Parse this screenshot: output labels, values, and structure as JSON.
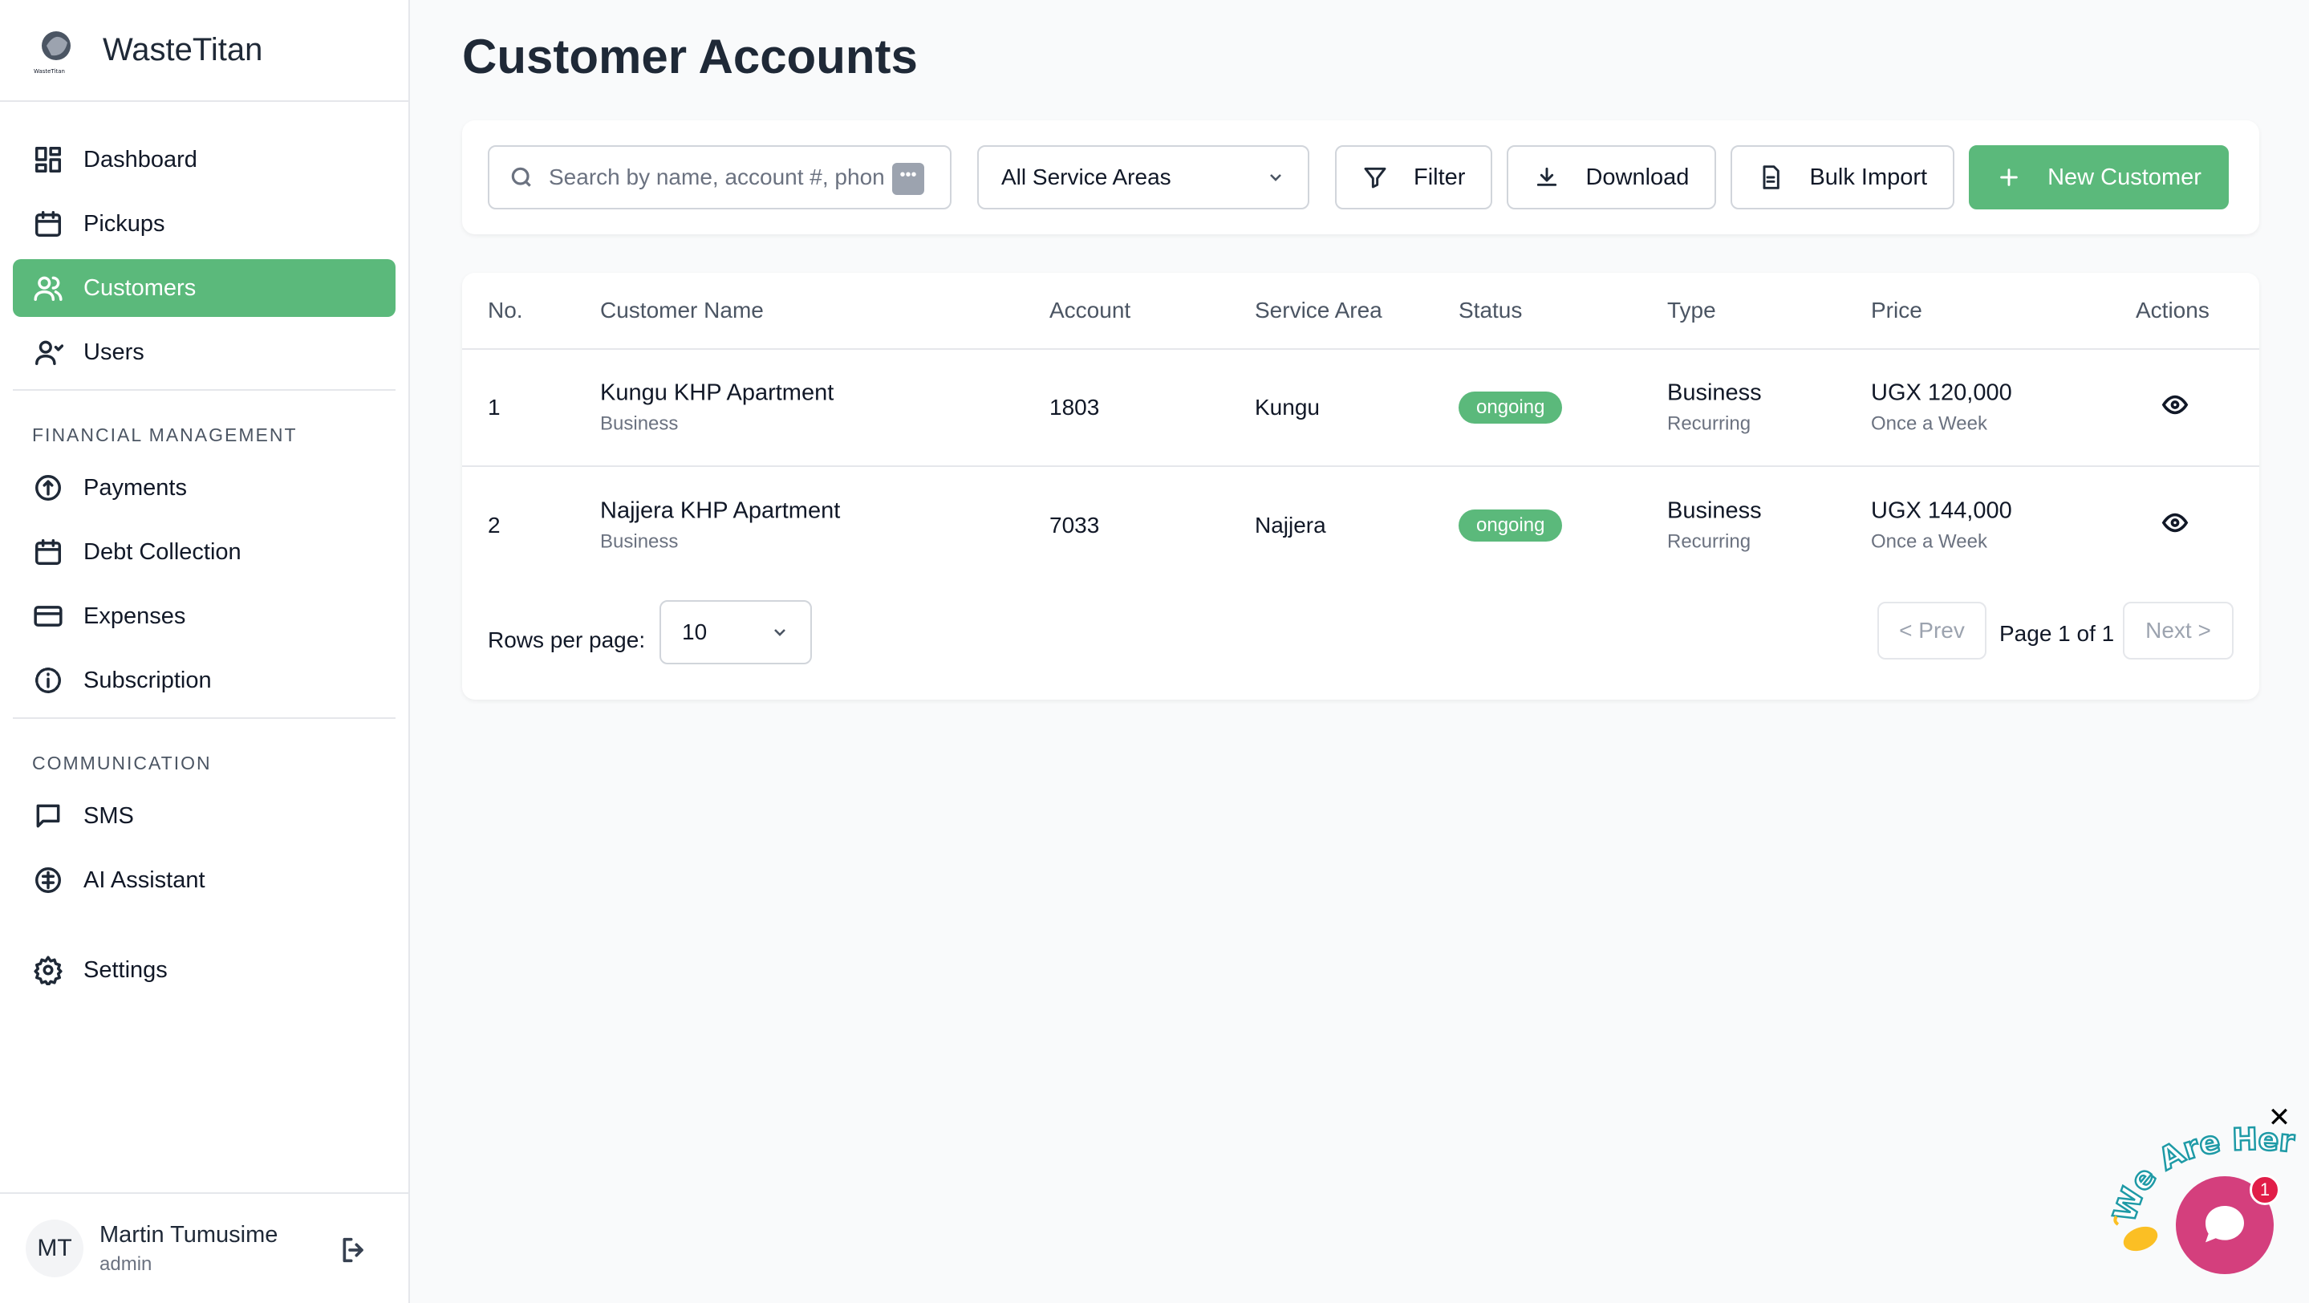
{
  "brand": {
    "name": "WasteTitan",
    "logo_text": "WasteTitan"
  },
  "sidebar": {
    "primary": [
      {
        "label": "Dashboard",
        "icon": "dashboard-icon"
      },
      {
        "label": "Pickups",
        "icon": "calendar-icon"
      },
      {
        "label": "Customers",
        "icon": "users-icon",
        "active": true
      },
      {
        "label": "Users",
        "icon": "user-icon"
      }
    ],
    "financial_label": "FINANCIAL MANAGEMENT",
    "financial": [
      {
        "label": "Payments",
        "icon": "payments-icon"
      },
      {
        "label": "Debt Collection",
        "icon": "calendar-icon"
      },
      {
        "label": "Expenses",
        "icon": "card-icon"
      },
      {
        "label": "Subscription",
        "icon": "info-icon"
      }
    ],
    "communication_label": "COMMUNICATION",
    "communication": [
      {
        "label": "SMS",
        "icon": "message-icon"
      },
      {
        "label": "AI Assistant",
        "icon": "ai-icon"
      }
    ],
    "settings": {
      "label": "Settings",
      "icon": "gear-icon"
    }
  },
  "user": {
    "initials": "MT",
    "name": "Martin Tumusime",
    "role": "admin"
  },
  "page": {
    "title": "Customer Accounts"
  },
  "toolbar": {
    "search_placeholder": "Search by name, account #, phone",
    "service_area": "All Service Areas",
    "filter_label": "Filter",
    "download_label": "Download",
    "bulk_import_label": "Bulk Import",
    "new_customer_label": "New Customer"
  },
  "table": {
    "headers": [
      "No.",
      "Customer Name",
      "Account",
      "Service Area",
      "Status",
      "Type",
      "Price",
      "Actions"
    ],
    "rows": [
      {
        "no": "1",
        "name": "Kungu KHP Apartment",
        "name_sub": "Business",
        "account": "1803",
        "area": "Kungu",
        "status": "ongoing",
        "type": "Business",
        "type_sub": "Recurring",
        "price": "UGX 120,000",
        "price_sub": "Once a Week"
      },
      {
        "no": "2",
        "name": "Najjera KHP Apartment",
        "name_sub": "Business",
        "account": "7033",
        "area": "Najjera",
        "status": "ongoing",
        "type": "Business",
        "type_sub": "Recurring",
        "price": "UGX 144,000",
        "price_sub": "Once a Week"
      }
    ]
  },
  "pagination": {
    "rows_label": "Rows per page:",
    "rows_value": "10",
    "prev": "< Prev",
    "info": "Page 1 of 1",
    "next": "Next >"
  },
  "chat": {
    "tagline": "We Are Here!",
    "count": "1",
    "close": "✕"
  },
  "colors": {
    "accent": "#5bb97b",
    "chat": "#d43f7d"
  }
}
